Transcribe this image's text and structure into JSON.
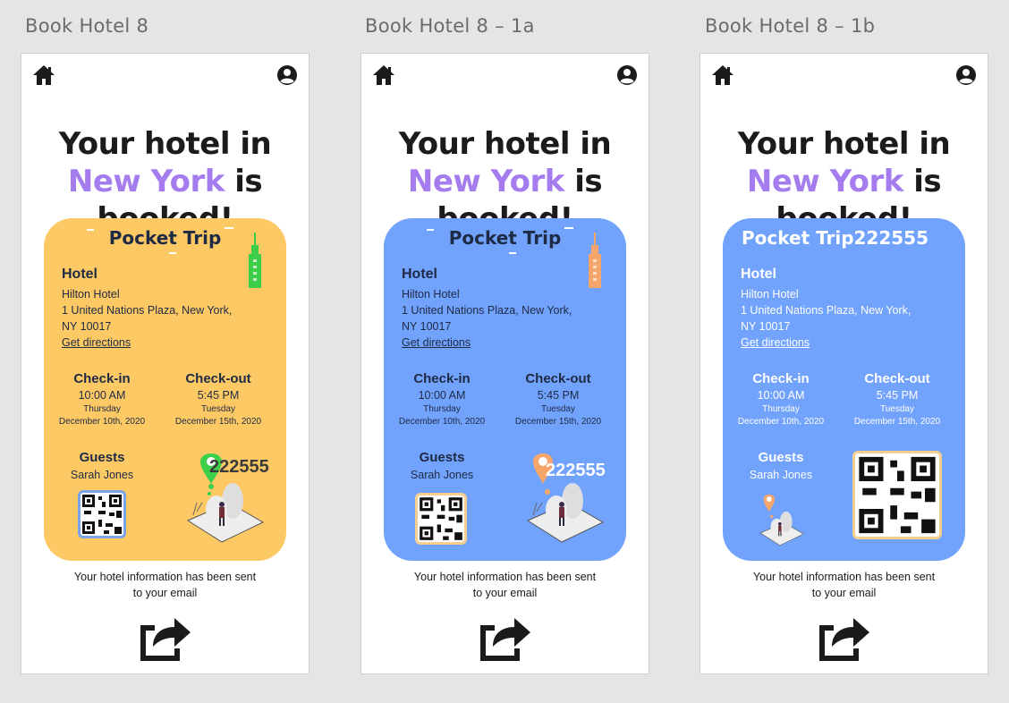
{
  "frames": [
    {
      "label": "Book Hotel 8",
      "headline_pre": "Your hotel in ",
      "headline_city": "New York",
      "headline_post": " is booked!",
      "card": {
        "theme": "yellow",
        "brand": "Pocket Trip",
        "hotel_heading": "Hotel",
        "hotel_name": "Hilton Hotel",
        "address_line1": "1 United Nations Plaza, New York,",
        "address_line2": "NY 10017",
        "directions": "Get directions",
        "checkin_label": "Check-in",
        "checkin_time": "10:00 AM",
        "checkin_day": "Thursday",
        "checkin_date": "December 10th, 2020",
        "checkout_label": "Check-out",
        "checkout_time": "5:45 PM",
        "checkout_day": "Tuesday",
        "checkout_date": "December 15th, 2020",
        "guests_label": "Guests",
        "guest_name": "Sarah Jones",
        "confirmation_code": "222555"
      },
      "footer_line1": "Your hotel information has been sent",
      "footer_line2": "to your email"
    },
    {
      "label": "Book Hotel 8 – 1a",
      "headline_pre": "Your hotel in ",
      "headline_city": "New York",
      "headline_post": " is booked!",
      "card": {
        "theme": "blue",
        "brand": "Pocket Trip",
        "hotel_heading": "Hotel",
        "hotel_name": "Hilton Hotel",
        "address_line1": "1 United Nations Plaza, New York,",
        "address_line2": "NY 10017",
        "directions": "Get directions",
        "checkin_label": "Check-in",
        "checkin_time": "10:00 AM",
        "checkin_day": "Thursday",
        "checkin_date": "December 10th, 2020",
        "checkout_label": "Check-out",
        "checkout_time": "5:45 PM",
        "checkout_day": "Tuesday",
        "checkout_date": "December 15th, 2020",
        "guests_label": "Guests",
        "guest_name": "Sarah Jones",
        "confirmation_code": "222555"
      },
      "footer_line1": "Your hotel information has been sent",
      "footer_line2": "to your email"
    },
    {
      "label": "Book Hotel 8 – 1b",
      "headline_pre": "Your hotel in ",
      "headline_city": "New York",
      "headline_post": " is booked!",
      "card": {
        "theme": "blue",
        "brand": "Pocket Trip",
        "hotel_heading": "Hotel",
        "hotel_name": "Hilton Hotel",
        "address_line1": "1 United Nations Plaza, New York,",
        "address_line2": "NY 10017",
        "directions": "Get directions",
        "checkin_label": "Check-in",
        "checkin_time": "10:00 AM",
        "checkin_day": "Thursday",
        "checkin_date": "December 10th, 2020",
        "checkout_label": "Check-out",
        "checkout_time": "5:45 PM",
        "checkout_day": "Tuesday",
        "checkout_date": "December 15th, 2020",
        "guests_label": "Guests",
        "guest_name": "Sarah Jones",
        "confirmation_code": "222555"
      },
      "footer_line1": "Your hotel information has been sent",
      "footer_line2": "to your email"
    }
  ],
  "colors": {
    "accent_purple": "#a47cee",
    "card_yellow": "#fcc965",
    "card_blue": "#71a2fc",
    "pin_green": "#3ecf4a",
    "pin_orange": "#f6a66b",
    "canvas_gray": "#e5e5e5"
  },
  "icons": {
    "nav_left": "home-icon",
    "nav_right": "user-account-icon",
    "footer": "share-icon",
    "card_decoration": "skyscraper-icon",
    "card_illustration": "location-pin-traveler-illustration",
    "qr": "qr-code-icon"
  }
}
